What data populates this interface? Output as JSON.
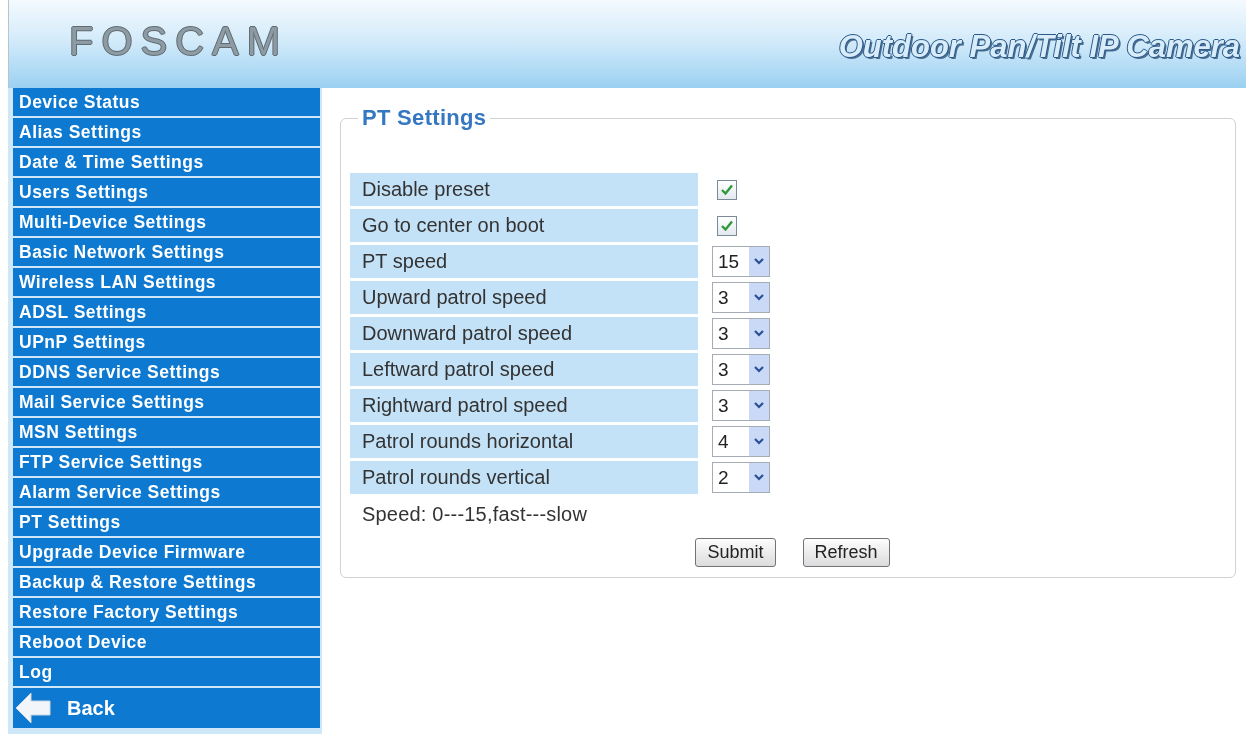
{
  "header": {
    "logo": "FOSCAM",
    "title": "Outdoor Pan/Tilt IP Camera"
  },
  "sidebar": {
    "items": [
      "Device Status",
      "Alias Settings",
      "Date & Time Settings",
      "Users Settings",
      "Multi-Device Settings",
      "Basic Network Settings",
      "Wireless LAN Settings",
      "ADSL Settings",
      "UPnP Settings",
      "DDNS Service Settings",
      "Mail Service Settings",
      "MSN Settings",
      "FTP Service Settings",
      "Alarm Service Settings",
      "PT Settings",
      "Upgrade Device Firmware",
      "Backup & Restore Settings",
      "Restore Factory Settings",
      "Reboot Device",
      "Log"
    ],
    "back": {
      "label": "Back"
    }
  },
  "panel": {
    "title": "PT Settings",
    "rows": [
      {
        "kind": "checkbox",
        "label": "Disable preset",
        "checked": true
      },
      {
        "kind": "checkbox",
        "label": "Go to center on boot",
        "checked": true
      },
      {
        "kind": "select",
        "label": "PT speed",
        "value": "15"
      },
      {
        "kind": "select",
        "label": "Upward patrol speed",
        "value": "3"
      },
      {
        "kind": "select",
        "label": "Downward patrol speed",
        "value": "3"
      },
      {
        "kind": "select",
        "label": "Leftward patrol speed",
        "value": "3"
      },
      {
        "kind": "select",
        "label": "Rightward patrol speed",
        "value": "3"
      },
      {
        "kind": "select",
        "label": "Patrol rounds horizontal",
        "value": "4"
      },
      {
        "kind": "select",
        "label": "Patrol rounds vertical",
        "value": "2"
      }
    ],
    "note": "Speed: 0---15,fast---slow",
    "buttons": [
      "Submit",
      "Refresh"
    ]
  }
}
